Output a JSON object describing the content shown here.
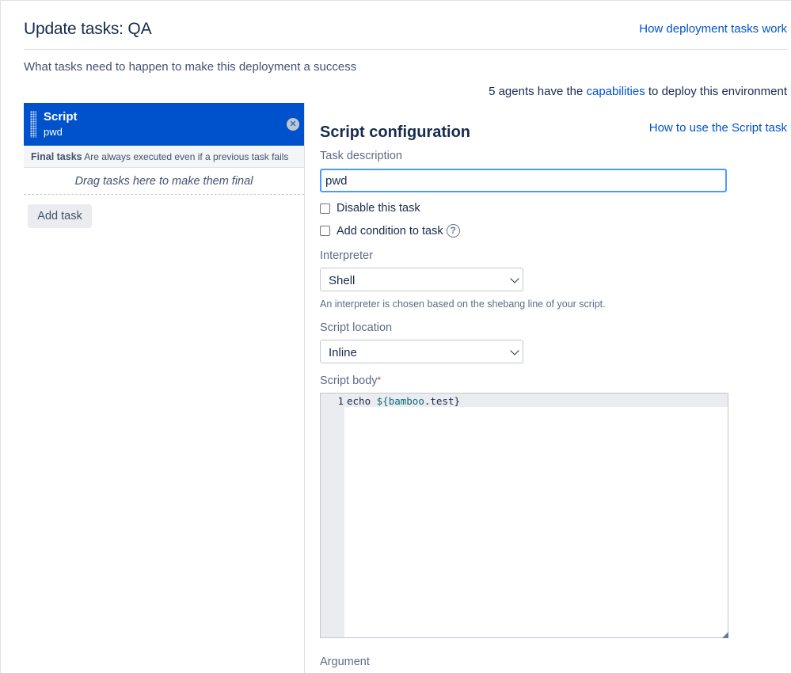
{
  "page": {
    "title": "Update tasks: QA",
    "help_link": "How deployment tasks work",
    "subtitle": "What tasks need to happen to make this deployment a success",
    "agents": {
      "prefix": "5 agents have the",
      "link": "capabilities",
      "suffix": "to deploy this environment"
    }
  },
  "task_list": {
    "items": [
      {
        "name": "Script",
        "description": "pwd"
      }
    ],
    "final_tasks": {
      "label": "Final tasks",
      "description": "Are always executed even if a previous task fails"
    },
    "drag_zone": "Drag tasks here to make them final",
    "add_task_label": "Add task"
  },
  "config": {
    "title": "Script configuration",
    "help_link": "How to use the Script task",
    "task_description_label": "Task description",
    "task_description_value": "pwd",
    "disable_label": "Disable this task",
    "condition_label": "Add condition to task",
    "interpreter_label": "Interpreter",
    "interpreter_value": "Shell",
    "interpreter_hint": "An interpreter is chosen based on the shebang line of your script.",
    "location_label": "Script location",
    "location_value": "Inline",
    "body_label": "Script body",
    "body_required_mark": "*",
    "code": {
      "line_number": "1",
      "prefix": "echo ",
      "var_open": "${",
      "var_name": "bamboo",
      "var_dot": ".",
      "var_prop": "test",
      "var_close": "}"
    },
    "argument_label": "Argument"
  },
  "colors": {
    "accent": "#0052cc",
    "focus": "#4c9aff",
    "required": "#de350b"
  }
}
